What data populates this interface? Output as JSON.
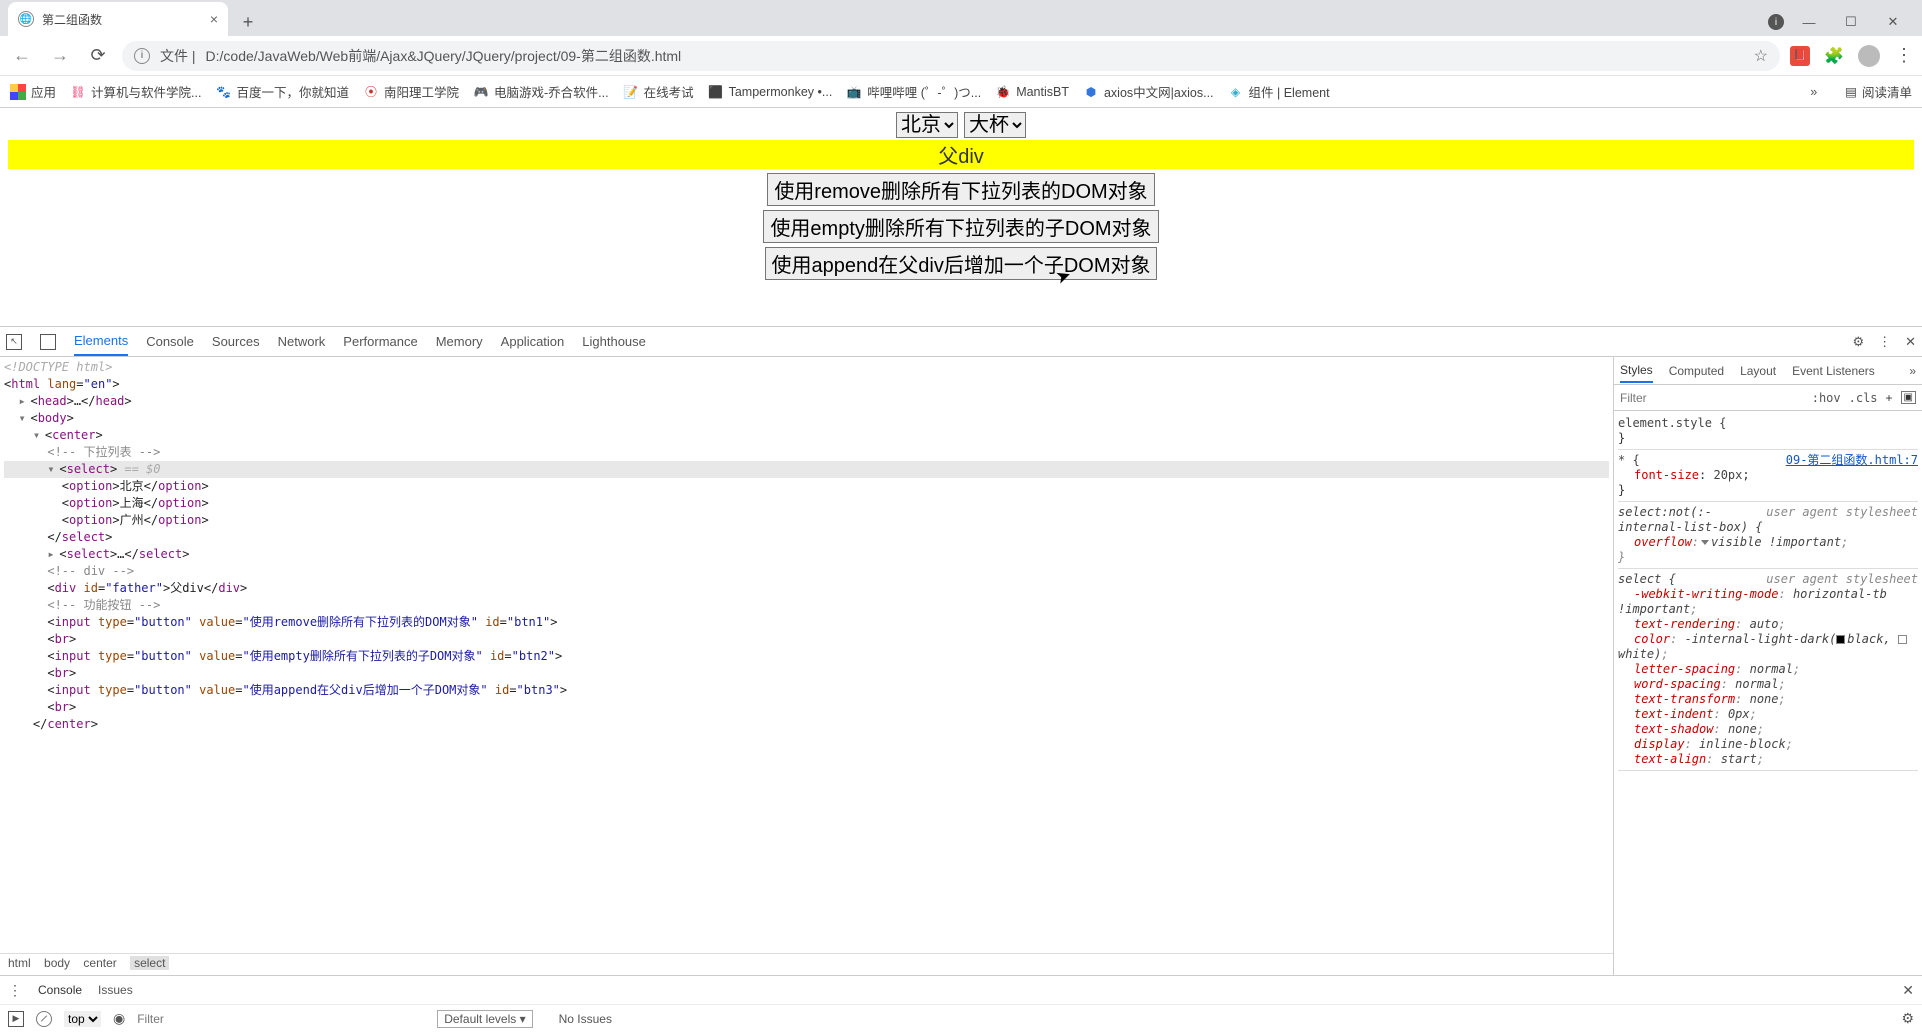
{
  "browser": {
    "tab_title": "第二组函数",
    "url_origin": "文件",
    "url_path": "D:/code/JavaWeb/Web前端/Ajax&JQuery/JQuery/project/09-第二组函数.html",
    "bookmarks": [
      {
        "label": "应用",
        "icon": "apps-icon"
      },
      {
        "label": "计算机与软件学院...",
        "icon": "link-icon"
      },
      {
        "label": "百度一下，你就知道",
        "icon": "baidu-icon"
      },
      {
        "label": "南阳理工学院",
        "icon": "nanyang-icon"
      },
      {
        "label": "电脑游戏-乔合软件...",
        "icon": "game-icon"
      },
      {
        "label": "在线考试",
        "icon": "exam-icon"
      },
      {
        "label": "Tampermonkey •...",
        "icon": "tm-icon"
      },
      {
        "label": "哔哩哔哩 (゜-゜)つ...",
        "icon": "bili-icon"
      },
      {
        "label": "MantisBT",
        "icon": "mantis-icon"
      },
      {
        "label": "axios中文网|axios...",
        "icon": "axios-icon"
      },
      {
        "label": "组件 | Element",
        "icon": "element-icon"
      }
    ],
    "reading_list": "阅读清单"
  },
  "page": {
    "select1": "北京",
    "select2": "大杯",
    "father_text": "父div",
    "btn1": "使用remove删除所有下拉列表的DOM对象",
    "btn2": "使用empty删除所有下拉列表的子DOM对象",
    "btn3": "使用append在父div后增加一个子DOM对象"
  },
  "devtools": {
    "tabs": [
      "Elements",
      "Console",
      "Sources",
      "Network",
      "Performance",
      "Memory",
      "Application",
      "Lighthouse"
    ],
    "active_tab": "Elements",
    "dom": {
      "doctype": "<!DOCTYPE html>",
      "html_open": "<html lang=\"en\">",
      "head": "<head>…</head>",
      "body": "<body>",
      "center": "<center>",
      "comment1": "<!-- 下拉列表 -->",
      "select_open": "<select>",
      "sel_eq": " == $0",
      "opt1_o": "<option>",
      "opt1_t": "北京",
      "opt1_c": "</option>",
      "opt2_o": "<option>",
      "opt2_t": "上海",
      "opt2_c": "</option>",
      "opt3_o": "<option>",
      "opt3_t": "广州",
      "opt3_c": "</option>",
      "select_close": "</select>",
      "select2": "<select>…</select>",
      "comment2": "<!-- div -->",
      "div_line": "<div id=\"father\">父div</div>",
      "comment3": "<!-- 功能按钮 -->",
      "input1": "<input type=\"button\" value=\"使用remove删除所有下拉列表的DOM对象\" id=\"btn1\">",
      "br": "<br>",
      "input2": "<input type=\"button\" value=\"使用empty删除所有下拉列表的子DOM对象\" id=\"btn2\">",
      "input3": "<input type=\"button\" value=\"使用append在父div后增加一个子DOM对象\" id=\"btn3\">",
      "center_close": "</center>"
    },
    "breadcrumbs": [
      "html",
      "body",
      "center",
      "select"
    ],
    "styles_tabs": [
      "Styles",
      "Computed",
      "Layout",
      "Event Listeners"
    ],
    "filter_placeholder": "Filter",
    "hov": ":hov",
    "cls": ".cls",
    "rules": {
      "element_style": "element.style {",
      "star": "* {",
      "star_src": "09-第二组函数.html:7",
      "star_prop": "font-size",
      "star_val": "20px",
      "sel_not": "select:not(:-internal-list-box) {",
      "ua": "user agent stylesheet",
      "overflow_prop": "overflow",
      "overflow_val": "visible !important",
      "select_sel": "select {",
      "wwm_prop": "-webkit-writing-mode",
      "wwm_val": "horizontal-tb !important",
      "tr_prop": "text-rendering",
      "tr_val": "auto",
      "color_prop": "color",
      "color_val": "-internal-light-dark(■black, □white)",
      "ls_prop": "letter-spacing",
      "ls_val": "normal",
      "ws_prop": "word-spacing",
      "ws_val": "normal",
      "tt_prop": "text-transform",
      "tt_val": "none",
      "ti_prop": "text-indent",
      "ti_val": "0px",
      "ts_prop": "text-shadow",
      "ts_val": "none",
      "disp_prop": "display",
      "disp_val": "inline-block",
      "ta_prop": "text-align",
      "ta_val": "start"
    },
    "drawer_tabs": [
      "Console",
      "Issues"
    ],
    "console": {
      "context": "top",
      "filter_placeholder": "Filter",
      "levels": "Default levels",
      "no_issues": "No Issues"
    }
  }
}
